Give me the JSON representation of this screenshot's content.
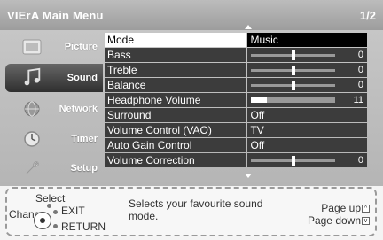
{
  "header": {
    "brand": "VIErA Main Menu",
    "page_indicator": "1/2"
  },
  "sidebar": {
    "items": [
      {
        "label": "Picture",
        "icon": "picture-icon"
      },
      {
        "label": "Sound",
        "icon": "sound-icon",
        "active": true
      },
      {
        "label": "Network",
        "icon": "network-icon"
      },
      {
        "label": "Timer",
        "icon": "timer-icon"
      },
      {
        "label": "Setup",
        "icon": "setup-icon"
      }
    ]
  },
  "menu": {
    "rows": [
      {
        "name": "Mode",
        "value": "Music",
        "kind": "text",
        "highlight": true
      },
      {
        "name": "Bass",
        "value": "0",
        "kind": "slider",
        "level": 0.5
      },
      {
        "name": "Treble",
        "value": "0",
        "kind": "slider",
        "level": 0.5
      },
      {
        "name": "Balance",
        "value": "0",
        "kind": "slider",
        "level": 0.5
      },
      {
        "name": "Headphone Volume",
        "value": "11",
        "kind": "volume",
        "level": 0.18
      },
      {
        "name": "Surround",
        "value": "Off",
        "kind": "text"
      },
      {
        "name": "Volume Control (VAO)",
        "value": "TV",
        "kind": "text"
      },
      {
        "name": "Auto Gain Control",
        "value": "Off",
        "kind": "text"
      },
      {
        "name": "Volume Correction",
        "value": "0",
        "kind": "slider",
        "level": 0.5
      }
    ]
  },
  "footer": {
    "select": "Select",
    "change": "Change",
    "exit": "EXIT",
    "return": "RETURN",
    "help_line1": "Selects your favourite sound",
    "help_line2": "mode.",
    "page_up": "Page up",
    "page_down": "Page down"
  },
  "colors": {
    "highlight_bg": "#ffffff",
    "row_bg": "#3c3c3c",
    "screen_bg": "#c0c0c0"
  }
}
